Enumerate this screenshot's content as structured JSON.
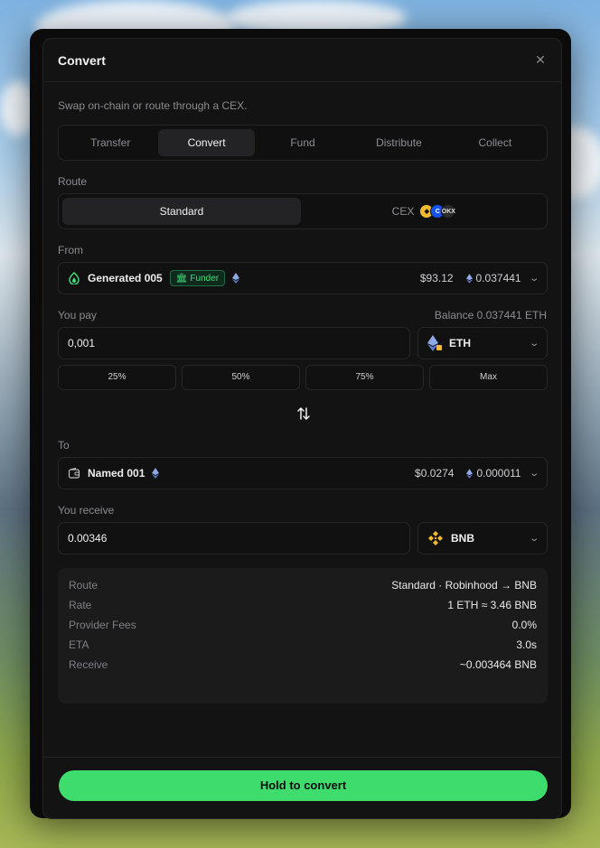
{
  "modal": {
    "title": "Convert",
    "subtitle": "Swap on-chain or route through a CEX."
  },
  "tabs": [
    {
      "label": "Transfer",
      "active": false
    },
    {
      "label": "Convert",
      "active": true
    },
    {
      "label": "Fund",
      "active": false
    },
    {
      "label": "Distribute",
      "active": false
    },
    {
      "label": "Collect",
      "active": false
    }
  ],
  "route": {
    "label": "Route",
    "options": [
      {
        "label": "Standard",
        "active": true
      },
      {
        "label": "CEX",
        "active": false,
        "exchange_icons": [
          "binance-icon",
          "coinbase-icon",
          "okx-icon"
        ],
        "third_icon_text": "OKX"
      }
    ]
  },
  "from": {
    "label": "From",
    "wallet_name": "Generated 005",
    "badge": "Funder",
    "usd_value": "$93.12",
    "eth_balance": "0.037441"
  },
  "pay": {
    "label": "You pay",
    "balance": "Balance 0.037441 ETH",
    "amount": "0,001",
    "token": "ETH",
    "percent_buttons": [
      "25%",
      "50%",
      "75%",
      "Max"
    ]
  },
  "to": {
    "label": "To",
    "wallet_name": "Named 001",
    "usd_value": "$0.0274",
    "eth_balance": "0.000011"
  },
  "receive": {
    "label": "You receive",
    "amount": "0.00346",
    "token": "BNB"
  },
  "summary": [
    {
      "key": "Route",
      "value": "Standard · Robinhood → BNB"
    },
    {
      "key": "Rate",
      "value": "1 ETH ≈ 3.46 BNB"
    },
    {
      "key": "Provider Fees",
      "value": "0.0%"
    },
    {
      "key": "ETA",
      "value": "3.0s"
    },
    {
      "key": "Receive",
      "value": "~0.003464 BNB"
    }
  ],
  "cta": "Hold to convert",
  "colors": {
    "accent_green": "#3ddc6d",
    "badge_green": "#3ee07a",
    "binance_yellow": "#f3ba2f",
    "coinbase_blue": "#1652f0",
    "eth_blue": "#6f8fd8"
  }
}
